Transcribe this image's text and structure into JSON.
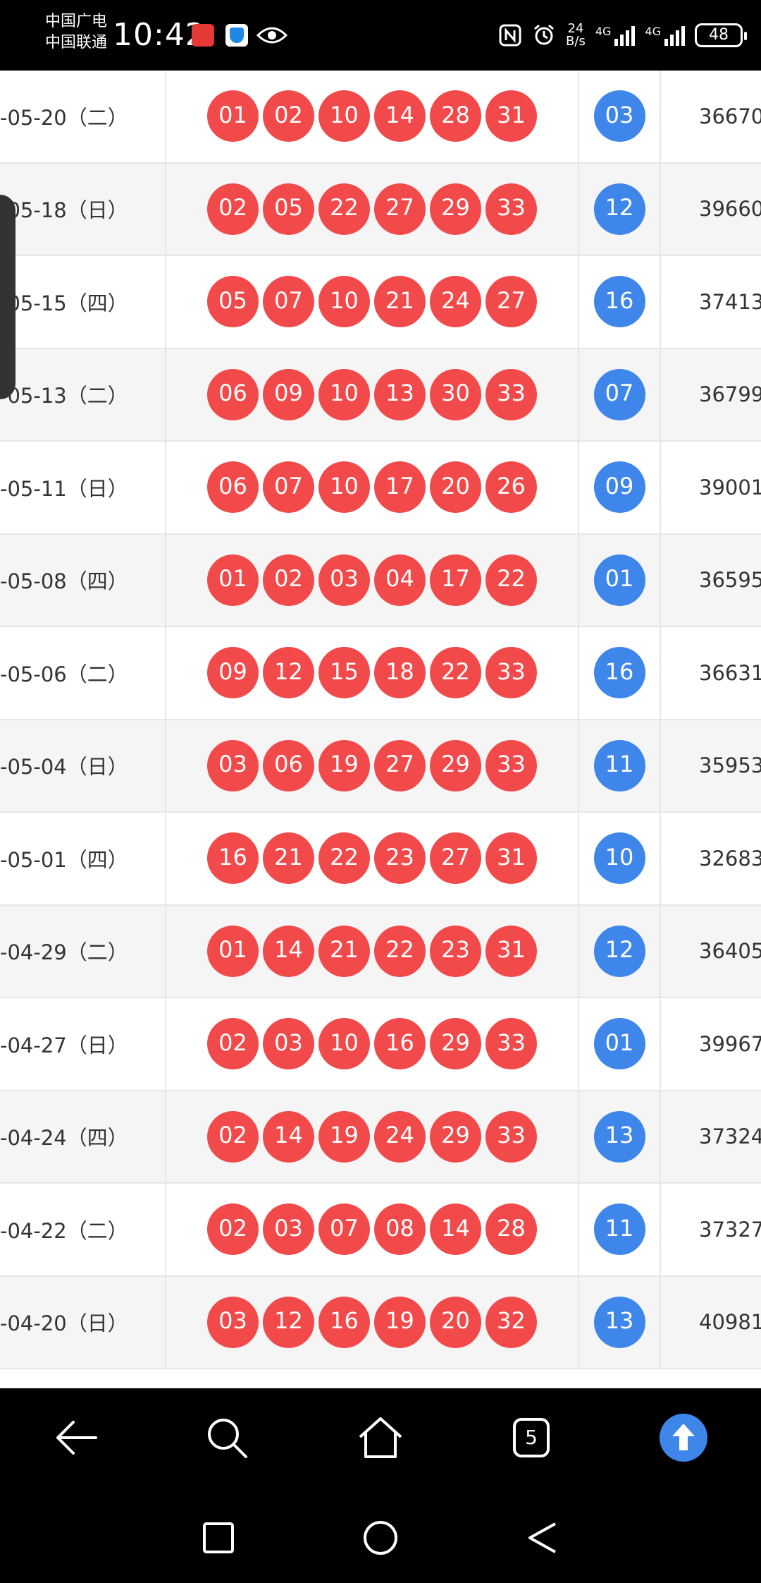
{
  "status_bar": {
    "carrier1": "中国广电",
    "carrier2": "中国联通",
    "time": "10:42",
    "net_speed_value": "24",
    "net_speed_unit": "B/s",
    "network1": "4G",
    "network2": "4G",
    "battery": "48",
    "icons": [
      "app-icon",
      "shield-icon",
      "eye-icon",
      "nfc-icon",
      "alarm-icon",
      "signal-icon",
      "battery-icon"
    ]
  },
  "colors": {
    "red_ball": "#f24a4a",
    "blue_ball": "#3f86ea",
    "row_alt": "#f5f5f5"
  },
  "draws": [
    {
      "date": "-05-20（二）",
      "red": [
        "01",
        "02",
        "10",
        "14",
        "28",
        "31"
      ],
      "blue": "03",
      "sales": "36670"
    },
    {
      "date": "-05-18（日）",
      "red": [
        "02",
        "05",
        "22",
        "27",
        "29",
        "33"
      ],
      "blue": "12",
      "sales": "39660"
    },
    {
      "date": "-05-15（四）",
      "red": [
        "05",
        "07",
        "10",
        "21",
        "24",
        "27"
      ],
      "blue": "16",
      "sales": "37413"
    },
    {
      "date": "-05-13（二）",
      "red": [
        "06",
        "09",
        "10",
        "13",
        "30",
        "33"
      ],
      "blue": "07",
      "sales": "36799"
    },
    {
      "date": "-05-11（日）",
      "red": [
        "06",
        "07",
        "10",
        "17",
        "20",
        "26"
      ],
      "blue": "09",
      "sales": "39001"
    },
    {
      "date": "-05-08（四）",
      "red": [
        "01",
        "02",
        "03",
        "04",
        "17",
        "22"
      ],
      "blue": "01",
      "sales": "36595"
    },
    {
      "date": "-05-06（二）",
      "red": [
        "09",
        "12",
        "15",
        "18",
        "22",
        "33"
      ],
      "blue": "16",
      "sales": "36631"
    },
    {
      "date": "-05-04（日）",
      "red": [
        "03",
        "06",
        "19",
        "27",
        "29",
        "33"
      ],
      "blue": "11",
      "sales": "35953"
    },
    {
      "date": "-05-01（四）",
      "red": [
        "16",
        "21",
        "22",
        "23",
        "27",
        "31"
      ],
      "blue": "10",
      "sales": "32683"
    },
    {
      "date": "-04-29（二）",
      "red": [
        "01",
        "14",
        "21",
        "22",
        "23",
        "31"
      ],
      "blue": "12",
      "sales": "36405"
    },
    {
      "date": "-04-27（日）",
      "red": [
        "02",
        "03",
        "10",
        "16",
        "29",
        "33"
      ],
      "blue": "01",
      "sales": "39967"
    },
    {
      "date": "-04-24（四）",
      "red": [
        "02",
        "14",
        "19",
        "24",
        "29",
        "33"
      ],
      "blue": "13",
      "sales": "37324"
    },
    {
      "date": "-04-22（二）",
      "red": [
        "02",
        "03",
        "07",
        "08",
        "14",
        "28"
      ],
      "blue": "11",
      "sales": "37327"
    },
    {
      "date": "-04-20（日）",
      "red": [
        "03",
        "12",
        "16",
        "19",
        "20",
        "32"
      ],
      "blue": "13",
      "sales": "40981"
    }
  ],
  "toolbar": {
    "tab_count": "5",
    "icons": [
      "back-icon",
      "search-icon",
      "home-icon",
      "tabs-icon",
      "scroll-top-icon"
    ]
  },
  "system_nav": {
    "icons": [
      "recents-icon",
      "home-circle-icon",
      "back-triangle-icon"
    ]
  }
}
